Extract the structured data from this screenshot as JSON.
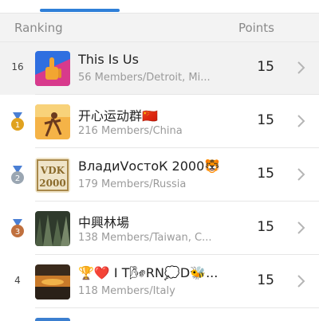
{
  "header": {
    "ranking_label": "Ranking",
    "points_label": "Points"
  },
  "rows": [
    {
      "rank": "16",
      "medal": "",
      "title": "This Is Us",
      "subtitle": "56 Members/Detroit, Mi...",
      "points": "15",
      "avatar_icon": "thumbs-up-icon"
    },
    {
      "rank": "1",
      "medal": "gold",
      "title": "开心运动群🇨🇳",
      "subtitle": "216 Members/China",
      "points": "15",
      "avatar_icon": "runner-photo"
    },
    {
      "rank": "2",
      "medal": "silver",
      "title": "ВладиVостоК 2000🐯",
      "subtitle": "179 Members/Russia",
      "points": "15",
      "avatar_icon": "vdk-logo"
    },
    {
      "rank": "3",
      "medal": "bronze",
      "title": "中興林場",
      "subtitle": "138 Members/Taiwan, C...",
      "points": "15",
      "avatar_icon": "forest-photo"
    },
    {
      "rank": "4",
      "medal": "",
      "title": "🏆❤️ I T🌬RN💭D🐝...",
      "subtitle": "118 Members/Italy",
      "points": "15",
      "avatar_icon": "sunset-photo"
    }
  ],
  "colors": {
    "accent": "#2f7fd8",
    "gold": "#e0a21f",
    "silver": "#9aa6b2",
    "bronze": "#c0703e"
  }
}
